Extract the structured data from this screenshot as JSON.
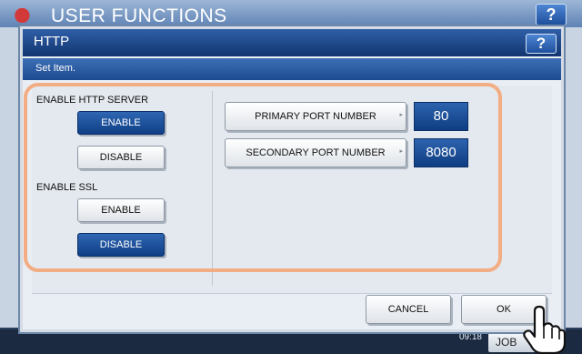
{
  "app": {
    "title": "USER FUNCTIONS",
    "help_label": "?",
    "clock": "09:18",
    "job_label": "JOB"
  },
  "dialog": {
    "title": "HTTP",
    "help_label": "?",
    "subtitle": "Set Item.",
    "http_server": {
      "label": "ENABLE HTTP SERVER",
      "enable_label": "ENABLE",
      "disable_label": "DISABLE",
      "selected": "ENABLE"
    },
    "ssl": {
      "label": "ENABLE SSL",
      "enable_label": "ENABLE",
      "disable_label": "DISABLE",
      "selected": "DISABLE"
    },
    "ports": {
      "primary_label": "PRIMARY PORT NUMBER",
      "primary_value": "80",
      "secondary_label": "SECONDARY PORT NUMBER",
      "secondary_value": "8080"
    },
    "cancel_label": "CANCEL",
    "ok_label": "OK"
  },
  "colors": {
    "accent": "#0f3f86",
    "highlight": "#f2ad84"
  },
  "icons": {
    "cursor": "hand-pointer-icon"
  }
}
